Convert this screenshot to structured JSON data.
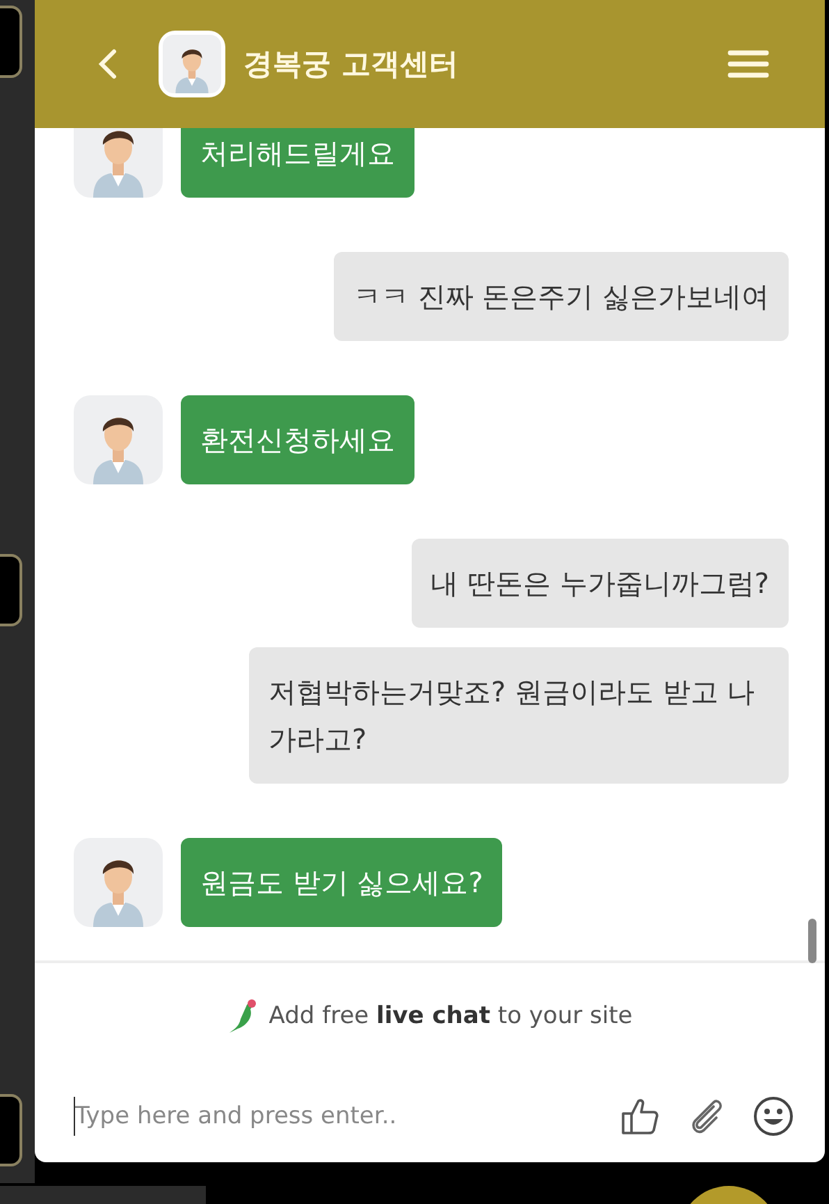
{
  "header": {
    "title": "경복궁 고객센터"
  },
  "messages": [
    {
      "kind": "agent",
      "text": "처리해드릴게요"
    },
    {
      "kind": "visitor",
      "text": "ㅋㅋ 진짜 돈은주기 싫은가보네여"
    },
    {
      "kind": "agent",
      "text": "환전신청하세요"
    },
    {
      "kind": "visitor",
      "text": "내 딴돈은 누가줍니까그럼?"
    },
    {
      "kind": "visitor",
      "text": "저협박하는거맞죠? 원금이라도 받고 나가라고?"
    },
    {
      "kind": "agent",
      "text": "원금도 받기 싫으세요?"
    }
  ],
  "branding": "Add free **live chat** to your site",
  "composer": {
    "placeholder": "Type here and press enter.."
  }
}
